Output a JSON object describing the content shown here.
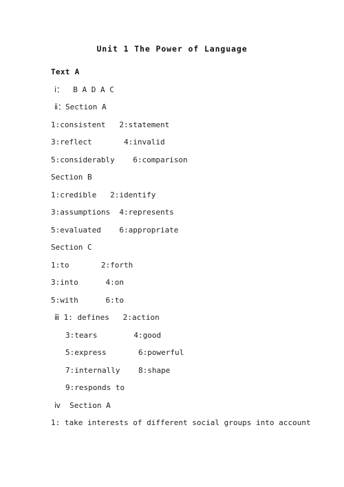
{
  "document": {
    "title": "Unit 1 The Power of Language",
    "section_heading": "Text A",
    "lines": [
      {
        "text": "ⅰ：  B A D A C",
        "indent": 1,
        "bold": false
      },
      {
        "text": "ⅱ：Section A",
        "indent": 1,
        "bold": false
      },
      {
        "text": "1:consistent   2:statement",
        "indent": 0,
        "bold": false
      },
      {
        "text": "3:reflect       4:invalid",
        "indent": 0,
        "bold": false
      },
      {
        "text": "5:considerably    6:comparison",
        "indent": 0,
        "bold": false
      },
      {
        "text": "Section B",
        "indent": 0,
        "bold": false
      },
      {
        "text": "1:credible   2:identify",
        "indent": 0,
        "bold": false
      },
      {
        "text": "3:assumptions  4:represents",
        "indent": 0,
        "bold": false
      },
      {
        "text": "5:evaluated    6:appropriate",
        "indent": 0,
        "bold": false
      },
      {
        "text": "Section C",
        "indent": 0,
        "bold": false
      },
      {
        "text": "1:to       2:forth",
        "indent": 0,
        "bold": false
      },
      {
        "text": "3:into      4:on",
        "indent": 0,
        "bold": false
      },
      {
        "text": "5:with      6:to",
        "indent": 0,
        "bold": false
      },
      {
        "text": "ⅲ 1: defines   2:action",
        "indent": 1,
        "bold": false
      },
      {
        "text": "3:tears        4:good",
        "indent": 2,
        "bold": false
      },
      {
        "text": "5:express       6:powerful",
        "indent": 2,
        "bold": false
      },
      {
        "text": "7:internally    8:shape",
        "indent": 2,
        "bold": false
      },
      {
        "text": "9:responds to",
        "indent": 2,
        "bold": false
      },
      {
        "text": "ⅳ  Section A",
        "indent": 1,
        "bold": false
      },
      {
        "text": "1: take interests of different social groups into account",
        "indent": 0,
        "bold": false
      }
    ]
  }
}
